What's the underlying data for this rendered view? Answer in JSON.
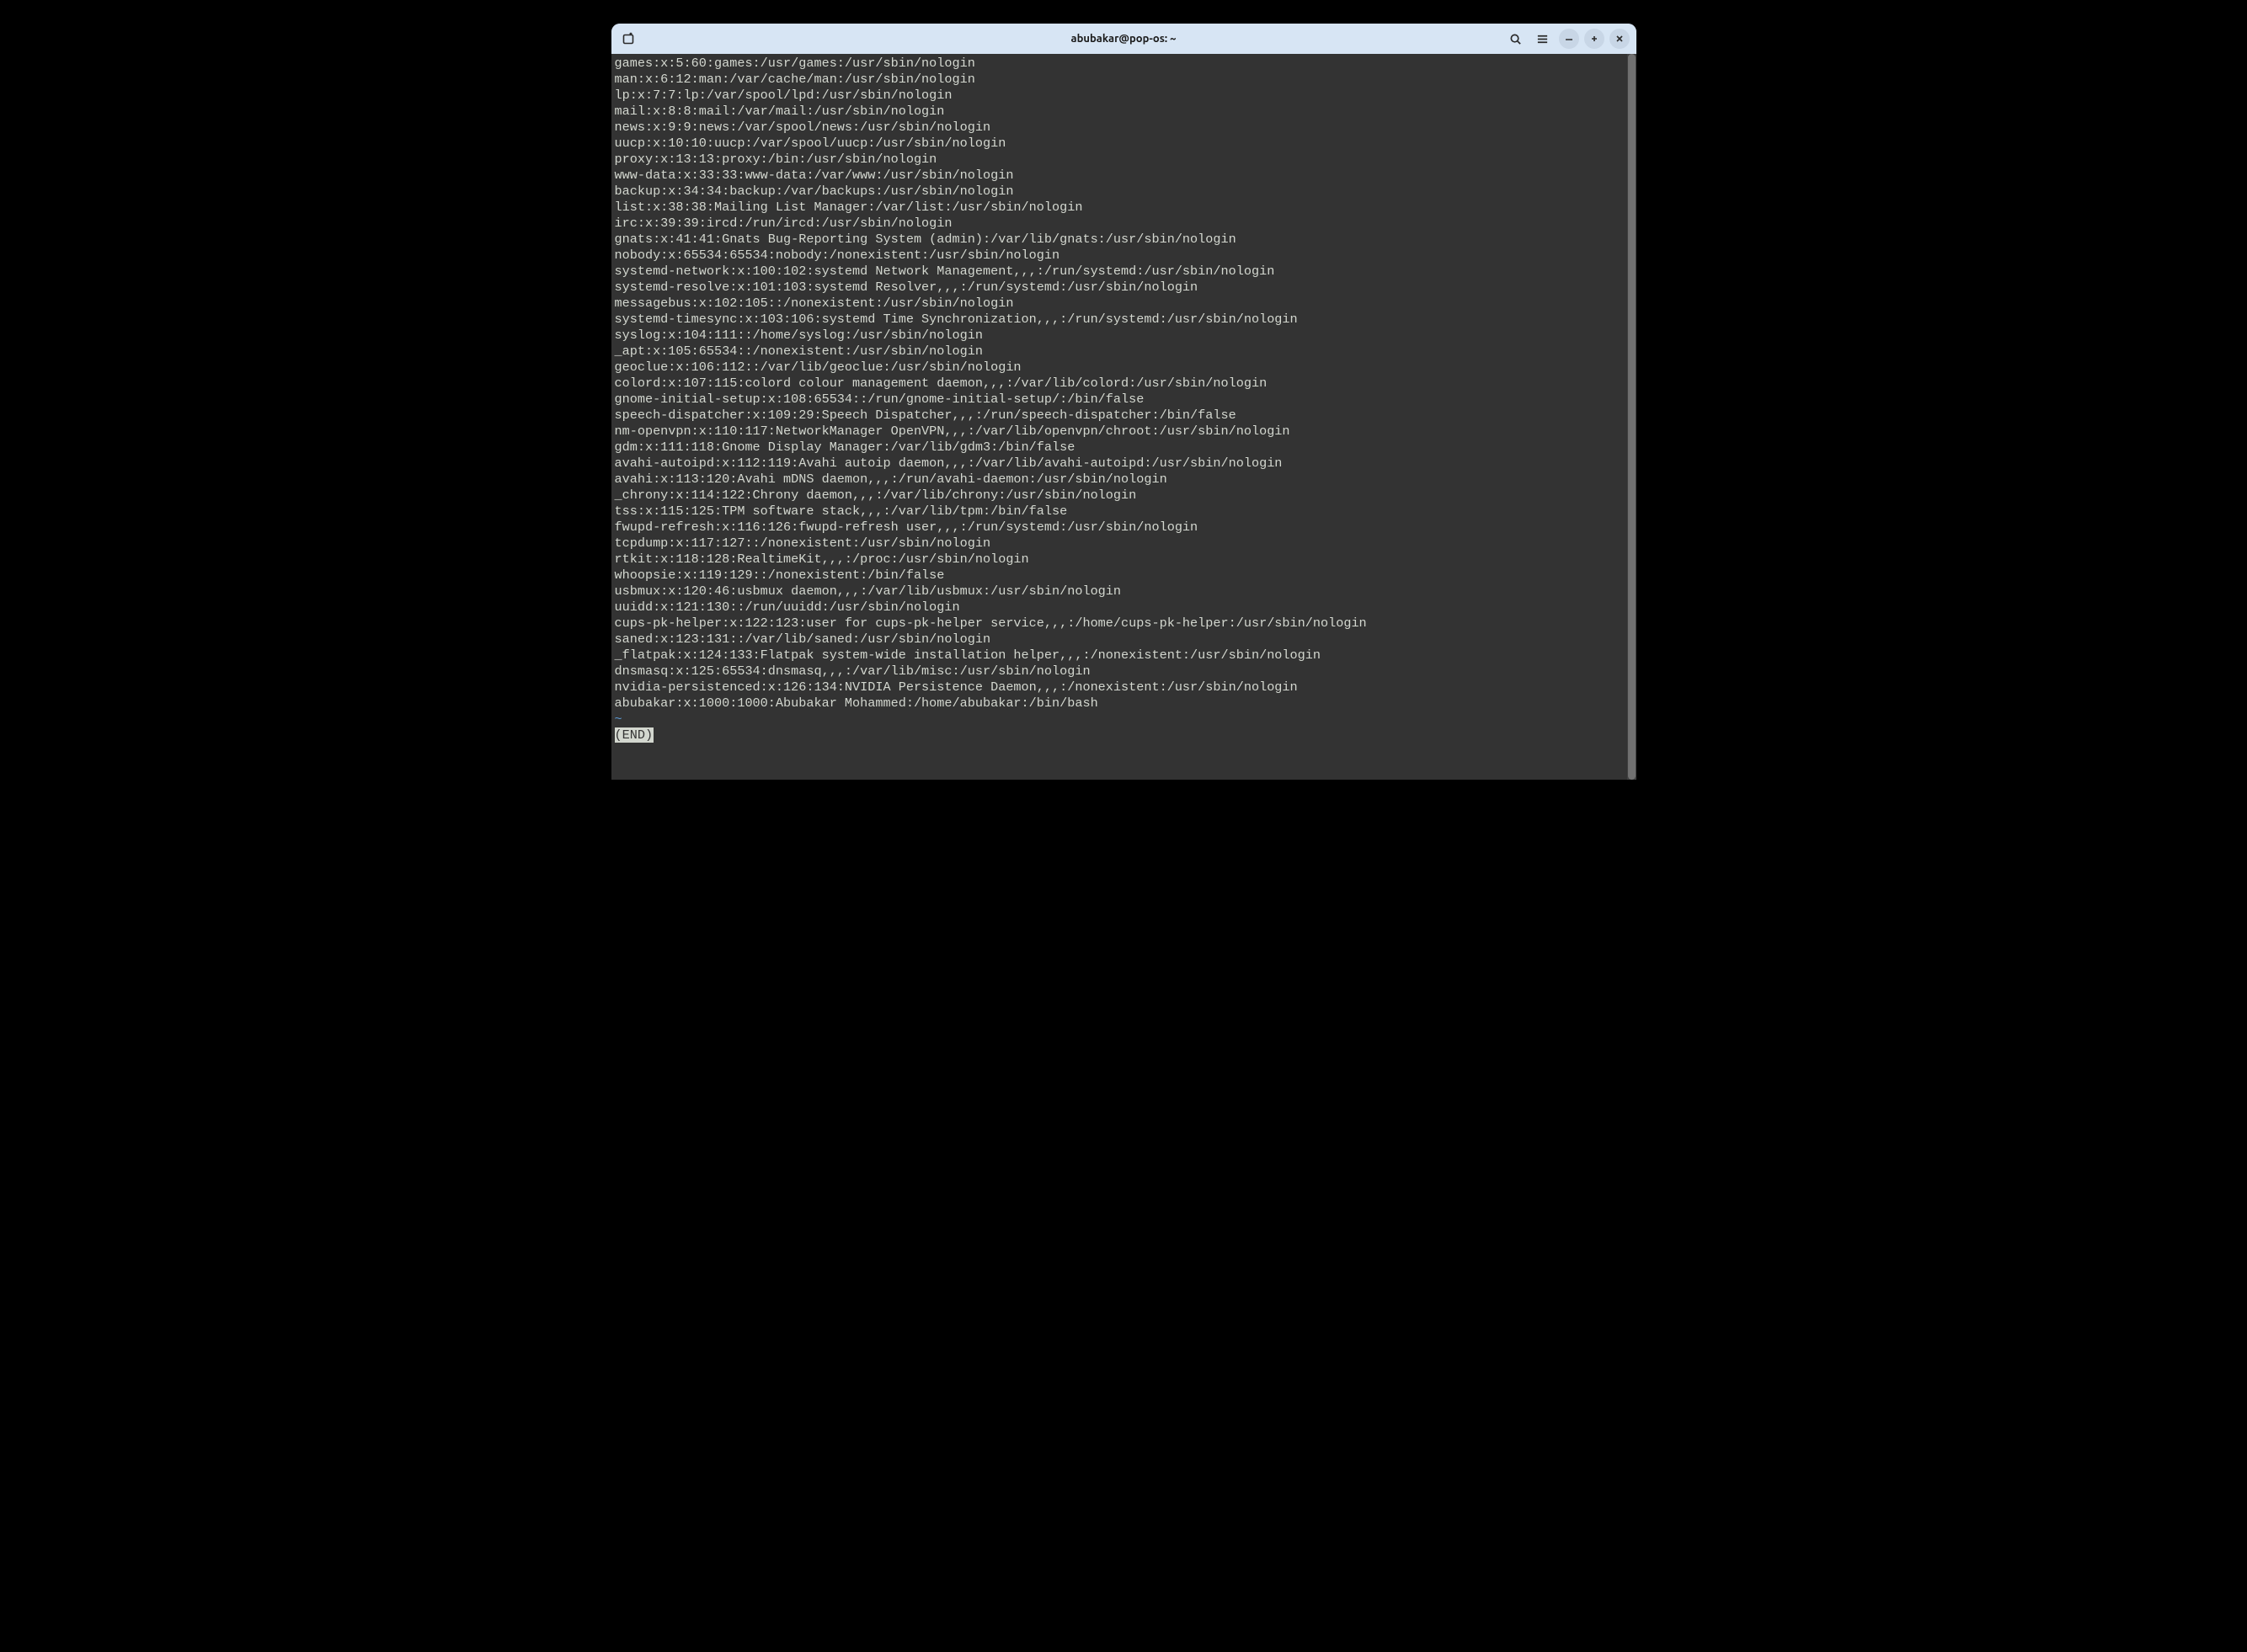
{
  "window": {
    "title": "abubakar@pop-os: ~"
  },
  "icons": {
    "new_tab": "new-tab-icon",
    "search": "search-icon",
    "menu": "hamburger-menu-icon",
    "minimize": "minimize-icon",
    "maximize": "maximize-icon",
    "close": "close-icon"
  },
  "terminal": {
    "lines": [
      "games:x:5:60:games:/usr/games:/usr/sbin/nologin",
      "man:x:6:12:man:/var/cache/man:/usr/sbin/nologin",
      "lp:x:7:7:lp:/var/spool/lpd:/usr/sbin/nologin",
      "mail:x:8:8:mail:/var/mail:/usr/sbin/nologin",
      "news:x:9:9:news:/var/spool/news:/usr/sbin/nologin",
      "uucp:x:10:10:uucp:/var/spool/uucp:/usr/sbin/nologin",
      "proxy:x:13:13:proxy:/bin:/usr/sbin/nologin",
      "www-data:x:33:33:www-data:/var/www:/usr/sbin/nologin",
      "backup:x:34:34:backup:/var/backups:/usr/sbin/nologin",
      "list:x:38:38:Mailing List Manager:/var/list:/usr/sbin/nologin",
      "irc:x:39:39:ircd:/run/ircd:/usr/sbin/nologin",
      "gnats:x:41:41:Gnats Bug-Reporting System (admin):/var/lib/gnats:/usr/sbin/nologin",
      "nobody:x:65534:65534:nobody:/nonexistent:/usr/sbin/nologin",
      "systemd-network:x:100:102:systemd Network Management,,,:/run/systemd:/usr/sbin/nologin",
      "systemd-resolve:x:101:103:systemd Resolver,,,:/run/systemd:/usr/sbin/nologin",
      "messagebus:x:102:105::/nonexistent:/usr/sbin/nologin",
      "systemd-timesync:x:103:106:systemd Time Synchronization,,,:/run/systemd:/usr/sbin/nologin",
      "syslog:x:104:111::/home/syslog:/usr/sbin/nologin",
      "_apt:x:105:65534::/nonexistent:/usr/sbin/nologin",
      "geoclue:x:106:112::/var/lib/geoclue:/usr/sbin/nologin",
      "colord:x:107:115:colord colour management daemon,,,:/var/lib/colord:/usr/sbin/nologin",
      "gnome-initial-setup:x:108:65534::/run/gnome-initial-setup/:/bin/false",
      "speech-dispatcher:x:109:29:Speech Dispatcher,,,:/run/speech-dispatcher:/bin/false",
      "nm-openvpn:x:110:117:NetworkManager OpenVPN,,,:/var/lib/openvpn/chroot:/usr/sbin/nologin",
      "gdm:x:111:118:Gnome Display Manager:/var/lib/gdm3:/bin/false",
      "avahi-autoipd:x:112:119:Avahi autoip daemon,,,:/var/lib/avahi-autoipd:/usr/sbin/nologin",
      "avahi:x:113:120:Avahi mDNS daemon,,,:/run/avahi-daemon:/usr/sbin/nologin",
      "_chrony:x:114:122:Chrony daemon,,,:/var/lib/chrony:/usr/sbin/nologin",
      "tss:x:115:125:TPM software stack,,,:/var/lib/tpm:/bin/false",
      "fwupd-refresh:x:116:126:fwupd-refresh user,,,:/run/systemd:/usr/sbin/nologin",
      "tcpdump:x:117:127::/nonexistent:/usr/sbin/nologin",
      "rtkit:x:118:128:RealtimeKit,,,:/proc:/usr/sbin/nologin",
      "whoopsie:x:119:129::/nonexistent:/bin/false",
      "usbmux:x:120:46:usbmux daemon,,,:/var/lib/usbmux:/usr/sbin/nologin",
      "uuidd:x:121:130::/run/uuidd:/usr/sbin/nologin",
      "cups-pk-helper:x:122:123:user for cups-pk-helper service,,,:/home/cups-pk-helper:/usr/sbin/nologin",
      "saned:x:123:131::/var/lib/saned:/usr/sbin/nologin",
      "_flatpak:x:124:133:Flatpak system-wide installation helper,,,:/nonexistent:/usr/sbin/nologin",
      "dnsmasq:x:125:65534:dnsmasq,,,:/var/lib/misc:/usr/sbin/nologin",
      "nvidia-persistenced:x:126:134:NVIDIA Persistence Daemon,,,:/nonexistent:/usr/sbin/nologin",
      "abubakar:x:1000:1000:Abubakar Mohammed:/home/abubakar:/bin/bash"
    ],
    "tilde": "~",
    "end_marker": "(END)"
  }
}
